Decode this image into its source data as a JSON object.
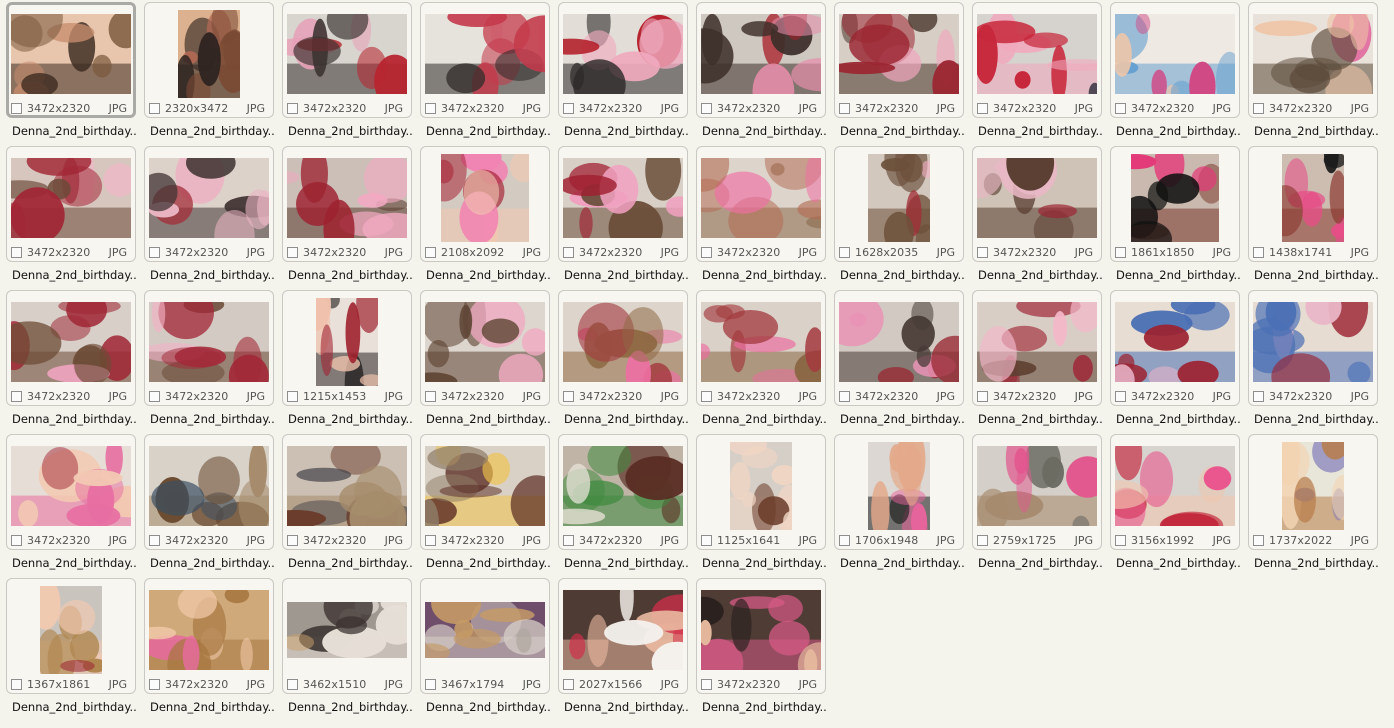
{
  "files": [
    {
      "dims": "3472x2320",
      "ext": "JPG",
      "name": "Denna_2nd_birthday...",
      "palette": [
        "#e8c6ae",
        "#c78d6d",
        "#7b5a3e",
        "#3d2b20"
      ],
      "orient": "land",
      "selected": true
    },
    {
      "dims": "2320x3472",
      "ext": "JPG",
      "name": "Denna_2nd_birthday...",
      "palette": [
        "#dcb18f",
        "#b46a55",
        "#7a4a34",
        "#2e2421"
      ],
      "orient": "port"
    },
    {
      "dims": "3472x2320",
      "ext": "JPG",
      "name": "Denna_2nd_birthday...",
      "palette": [
        "#d8d5cf",
        "#b7252f",
        "#e7a2b8",
        "#3a3230"
      ],
      "orient": "land"
    },
    {
      "dims": "3472x2320",
      "ext": "JPG",
      "name": "Denna_2nd_birthday...",
      "palette": [
        "#e6e2dc",
        "#c43a4b",
        "#f1b9c9",
        "#2f2b2a"
      ],
      "orient": "land"
    },
    {
      "dims": "3472x2320",
      "ext": "JPG",
      "name": "Denna_2nd_birthday...",
      "palette": [
        "#e2ded7",
        "#b4202b",
        "#efa9be",
        "#2d2a29"
      ],
      "orient": "land"
    },
    {
      "dims": "3472x2320",
      "ext": "JPG",
      "name": "Denna_2nd_birthday...",
      "palette": [
        "#cfc8c0",
        "#a81f2a",
        "#e58eaa",
        "#3e2f2a"
      ],
      "orient": "land"
    },
    {
      "dims": "3472x2320",
      "ext": "JPG",
      "name": "Denna_2nd_birthday...",
      "palette": [
        "#d7cfc6",
        "#9b2632",
        "#f0a5bd",
        "#4a362b"
      ],
      "orient": "land"
    },
    {
      "dims": "3472x2320",
      "ext": "JPG",
      "name": "Denna_2nd_birthday...",
      "palette": [
        "#d6d3cf",
        "#242734",
        "#c8283b",
        "#f1a8be"
      ],
      "orient": "land"
    },
    {
      "dims": "3472x2320",
      "ext": "JPG",
      "name": "Denna_2nd_birthday...",
      "palette": [
        "#efe9e3",
        "#f0c6a8",
        "#d04a86",
        "#66a0d0"
      ],
      "orient": "land"
    },
    {
      "dims": "3472x2320",
      "ext": "JPG",
      "name": "Denna_2nd_birthday...",
      "palette": [
        "#e9e2da",
        "#efc4a6",
        "#e06a9e",
        "#5b4a3a"
      ],
      "orient": "land"
    },
    {
      "dims": "3472x2320",
      "ext": "JPG",
      "name": "Denna_2nd_birthday...",
      "palette": [
        "#d7c6bd",
        "#a12635",
        "#f0b8c8",
        "#6c4a38"
      ],
      "orient": "land"
    },
    {
      "dims": "3472x2320",
      "ext": "JPG",
      "name": "Denna_2nd_birthday...",
      "palette": [
        "#ddd2ca",
        "#a52c38",
        "#eab6c4",
        "#423534"
      ],
      "orient": "land"
    },
    {
      "dims": "3472x2320",
      "ext": "JPG",
      "name": "Denna_2nd_birthday...",
      "palette": [
        "#cbbfb8",
        "#9e2230",
        "#f2a9c1",
        "#5d3e31"
      ],
      "orient": "land"
    },
    {
      "dims": "2108x2092",
      "ext": "JPG",
      "name": "Denna_2nd_birthday...",
      "palette": [
        "#d3cbc2",
        "#a8293a",
        "#f184b2",
        "#f2c8b0"
      ],
      "orient": "square"
    },
    {
      "dims": "3472x2320",
      "ext": "JPG",
      "name": "Denna_2nd_birthday...",
      "palette": [
        "#d8d0c7",
        "#a01f30",
        "#f1a1c0",
        "#6b4f3a"
      ],
      "orient": "land"
    },
    {
      "dims": "3472x2320",
      "ext": "JPG",
      "name": "Denna_2nd_birthday...",
      "palette": [
        "#ddd5cc",
        "#b36a52",
        "#ef6fa4",
        "#8a6a4a"
      ],
      "orient": "land"
    },
    {
      "dims": "1628x2035",
      "ext": "JPG",
      "name": "Denna_2nd_birthday...",
      "palette": [
        "#d2c8be",
        "#a22b36",
        "#f4b3c6",
        "#6d513b"
      ],
      "orient": "port"
    },
    {
      "dims": "3472x2320",
      "ext": "JPG",
      "name": "Denna_2nd_birthday...",
      "palette": [
        "#cfc2b6",
        "#9b2432",
        "#e9b8c6",
        "#5a3f32"
      ],
      "orient": "land"
    },
    {
      "dims": "1861x1850",
      "ext": "JPG",
      "name": "Denna_2nd_birthday...",
      "palette": [
        "#c9b9ae",
        "#111111",
        "#e33a78",
        "#7a3a2e"
      ],
      "orient": "square"
    },
    {
      "dims": "1438x1741",
      "ext": "JPG",
      "name": "Denna_2nd_birthday...",
      "palette": [
        "#cdbdb1",
        "#1b1b1b",
        "#e64d86",
        "#8b3a31"
      ],
      "orient": "port"
    },
    {
      "dims": "3472x2320",
      "ext": "JPG",
      "name": "Denna_2nd_birthday...",
      "palette": [
        "#d7cfc8",
        "#a02734",
        "#f0a4c1",
        "#6d4b35"
      ],
      "orient": "land"
    },
    {
      "dims": "3472x2320",
      "ext": "JPG",
      "name": "Denna_2nd_birthday...",
      "palette": [
        "#d3cbc3",
        "#a32838",
        "#f1b0c5",
        "#6a4935"
      ],
      "orient": "land"
    },
    {
      "dims": "1215x1453",
      "ext": "JPG",
      "name": "Denna_2nd_birthday...",
      "palette": [
        "#e9e0d9",
        "#a0222f",
        "#f0c2ad",
        "#2b2626"
      ],
      "orient": "port"
    },
    {
      "dims": "3472x2320",
      "ext": "JPG",
      "name": "Denna_2nd_birthday...",
      "palette": [
        "#ddd6ce",
        "#a02734",
        "#f0a9c1",
        "#5f4634"
      ],
      "orient": "land"
    },
    {
      "dims": "3472x2320",
      "ext": "JPG",
      "name": "Denna_2nd_birthday...",
      "palette": [
        "#ddd4cb",
        "#a43b3f",
        "#ee6fa3",
        "#8f6a44"
      ],
      "orient": "land"
    },
    {
      "dims": "3472x2320",
      "ext": "JPG",
      "name": "Denna_2nd_birthday...",
      "palette": [
        "#dad1c8",
        "#a33a3e",
        "#ec6b9f",
        "#8a6744"
      ],
      "orient": "land"
    },
    {
      "dims": "3472x2320",
      "ext": "JPG",
      "name": "Denna_2nd_birthday...",
      "palette": [
        "#d2cac2",
        "#9a2a35",
        "#e994b6",
        "#473a35"
      ],
      "orient": "land"
    },
    {
      "dims": "3472x2320",
      "ext": "JPG",
      "name": "Denna_2nd_birthday...",
      "palette": [
        "#d8cec6",
        "#9e2433",
        "#f3b8c9",
        "#5e3f31"
      ],
      "orient": "land"
    },
    {
      "dims": "3472x2320",
      "ext": "JPG",
      "name": "Denna_2nd_birthday...",
      "palette": [
        "#e7ddd3",
        "#9d2230",
        "#e8b4c8",
        "#4a6fb4"
      ],
      "orient": "land"
    },
    {
      "dims": "3472x2320",
      "ext": "JPG",
      "name": "Denna_2nd_birthday...",
      "palette": [
        "#e6dcd2",
        "#9a2230",
        "#eab7c8",
        "#4b70b5"
      ],
      "orient": "land"
    },
    {
      "dims": "3472x2320",
      "ext": "JPG",
      "name": "Denna_2nd_birthday...",
      "palette": [
        "#e6ddd6",
        "#a22636",
        "#f2c9b2",
        "#e76ea1"
      ],
      "orient": "land"
    },
    {
      "dims": "3472x2320",
      "ext": "JPG",
      "name": "Denna_2nd_birthday...",
      "palette": [
        "#d8d2c9",
        "#3a4e63",
        "#6a4a2f",
        "#a58c6b"
      ],
      "orient": "land"
    },
    {
      "dims": "3472x2320",
      "ext": "JPG",
      "name": "Denna_2nd_birthday...",
      "palette": [
        "#ccbfb3",
        "#6a3d2c",
        "#45434a",
        "#a58c6b"
      ],
      "orient": "land"
    },
    {
      "dims": "3472x2320",
      "ext": "JPG",
      "name": "Denna_2nd_birthday...",
      "palette": [
        "#d9d1c5",
        "#5a2b22",
        "#8e7c66",
        "#f0c24a"
      ],
      "orient": "land"
    },
    {
      "dims": "3472x2320",
      "ext": "JPG",
      "name": "Denna_2nd_birthday...",
      "palette": [
        "#bfb4a6",
        "#5a2d23",
        "#e8e3d8",
        "#3f8a3f"
      ],
      "orient": "land"
    },
    {
      "dims": "1125x1641",
      "ext": "JPG",
      "name": "Denna_2nd_birthday...",
      "palette": [
        "#d5cfc7",
        "#6b3d2a",
        "#3a2d2a",
        "#efd5c4"
      ],
      "orient": "port"
    },
    {
      "dims": "1706x1948",
      "ext": "JPG",
      "name": "Denna_2nd_birthday...",
      "palette": [
        "#dcd7d3",
        "#e3a889",
        "#e7649c",
        "#1f1f1f"
      ],
      "orient": "port"
    },
    {
      "dims": "2759x1725",
      "ext": "JPG",
      "name": "Denna_2nd_birthday...",
      "palette": [
        "#d4cfc8",
        "#e2578f",
        "#6b6b63",
        "#a68a6e"
      ],
      "orient": "land"
    },
    {
      "dims": "3156x1992",
      "ext": "JPG",
      "name": "Denna_2nd_birthday...",
      "palette": [
        "#d7d3cf",
        "#e9538c",
        "#c21f35",
        "#f0c6ae"
      ],
      "orient": "land"
    },
    {
      "dims": "1737x2022",
      "ext": "JPG",
      "name": "Denna_2nd_birthday...",
      "palette": [
        "#e8e6d8",
        "#f2d3b2",
        "#7f79b8",
        "#b87d4a"
      ],
      "orient": "port"
    },
    {
      "dims": "1367x1861",
      "ext": "JPG",
      "name": "Denna_2nd_birthday...",
      "palette": [
        "#c9c4be",
        "#9c2a32",
        "#b0874f",
        "#f2c9b0"
      ],
      "orient": "port"
    },
    {
      "dims": "3472x2320",
      "ext": "JPG",
      "name": "Denna_2nd_birthday...",
      "palette": [
        "#cfa97a",
        "#f0c8a8",
        "#e86aa0",
        "#a6763f"
      ],
      "orient": "land"
    },
    {
      "dims": "3462x1510",
      "ext": "JPG",
      "name": "Denna_2nd_birthday...",
      "palette": [
        "#9f9891",
        "#3b3330",
        "#c9a16c",
        "#e6dfd7"
      ],
      "orient": "wide"
    },
    {
      "dims": "3467x1794",
      "ext": "JPG",
      "name": "Denna_2nd_birthday...",
      "palette": [
        "#6e4e6a",
        "#3b3330",
        "#c49a66",
        "#d8d0c8"
      ],
      "orient": "wide"
    },
    {
      "dims": "2027x1566",
      "ext": "JPG",
      "name": "Denna_2nd_birthday...",
      "palette": [
        "#4e3b34",
        "#f4f0ec",
        "#d22e4a",
        "#e8b79e"
      ],
      "orient": "land"
    },
    {
      "dims": "3472x2320",
      "ext": "JPG",
      "name": "Denna_2nd_birthday...",
      "palette": [
        "#4f3c35",
        "#e5b89d",
        "#2b2220",
        "#d65a86"
      ],
      "orient": "land"
    }
  ]
}
